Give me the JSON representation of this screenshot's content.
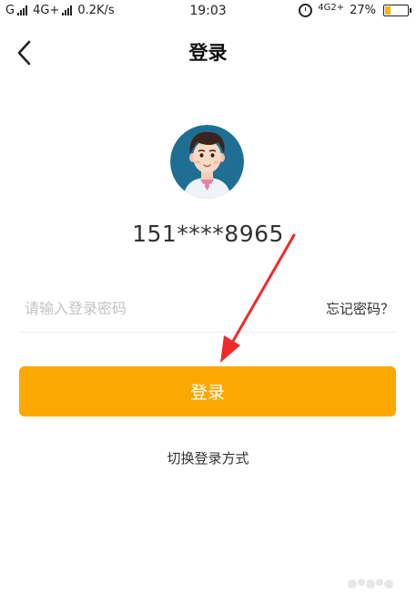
{
  "status_bar": {
    "carrier_left": "G",
    "network": "4G+",
    "speed": "0.2K/s",
    "time": "19:03",
    "network_right": "4G2+",
    "battery_percent_text": "27%",
    "battery_level": 0.27,
    "battery_color": "#f5b400"
  },
  "header": {
    "back_icon": "chevron-left-icon",
    "title": "登录"
  },
  "account": {
    "avatar_icon": "user-avatar-icon",
    "phone": "151****8965"
  },
  "password": {
    "placeholder": "请输入登录密码",
    "value": "",
    "forgot_label": "忘记密码？"
  },
  "login_button": {
    "label": "登录",
    "color": "#fda800"
  },
  "switch_method_label": "切换登录方式",
  "annotation": {
    "arrow_color": "#ee2a2a"
  }
}
